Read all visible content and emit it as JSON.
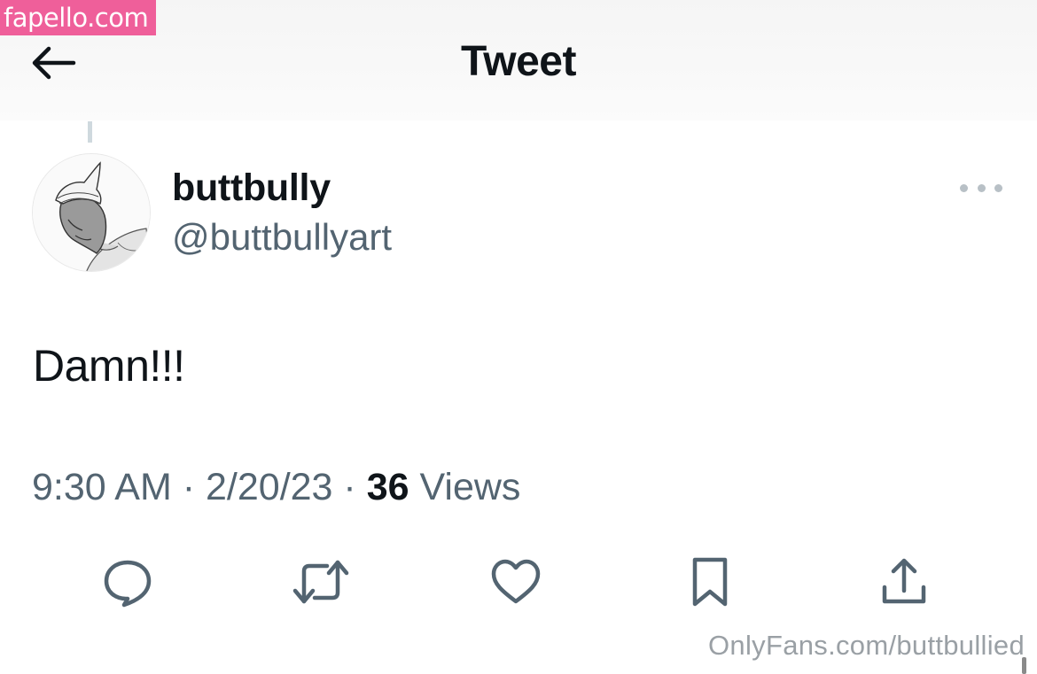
{
  "watermark_top": "fapello.com",
  "header": {
    "title": "Tweet",
    "back_icon": "arrow-left-icon"
  },
  "tweet": {
    "display_name": "buttbully",
    "handle": "@buttbullyart",
    "text": "Damn!!!",
    "time": "9:30 AM",
    "date": "2/20/23",
    "views_count": "36",
    "views_label": "Views",
    "separator": "·"
  },
  "actions": [
    {
      "name": "reply",
      "icon": "speech-bubble-icon"
    },
    {
      "name": "retweet",
      "icon": "retweet-icon"
    },
    {
      "name": "like",
      "icon": "heart-icon"
    },
    {
      "name": "bookmark",
      "icon": "bookmark-icon"
    },
    {
      "name": "share",
      "icon": "share-icon"
    }
  ],
  "more_icon": "more-horizontal-icon",
  "watermark_bottom": "OnlyFans.com/buttbullied",
  "colors": {
    "text_primary": "#0f1419",
    "text_secondary": "#536471",
    "icon": "#536471",
    "watermark_pink": "#ef5f9a"
  }
}
